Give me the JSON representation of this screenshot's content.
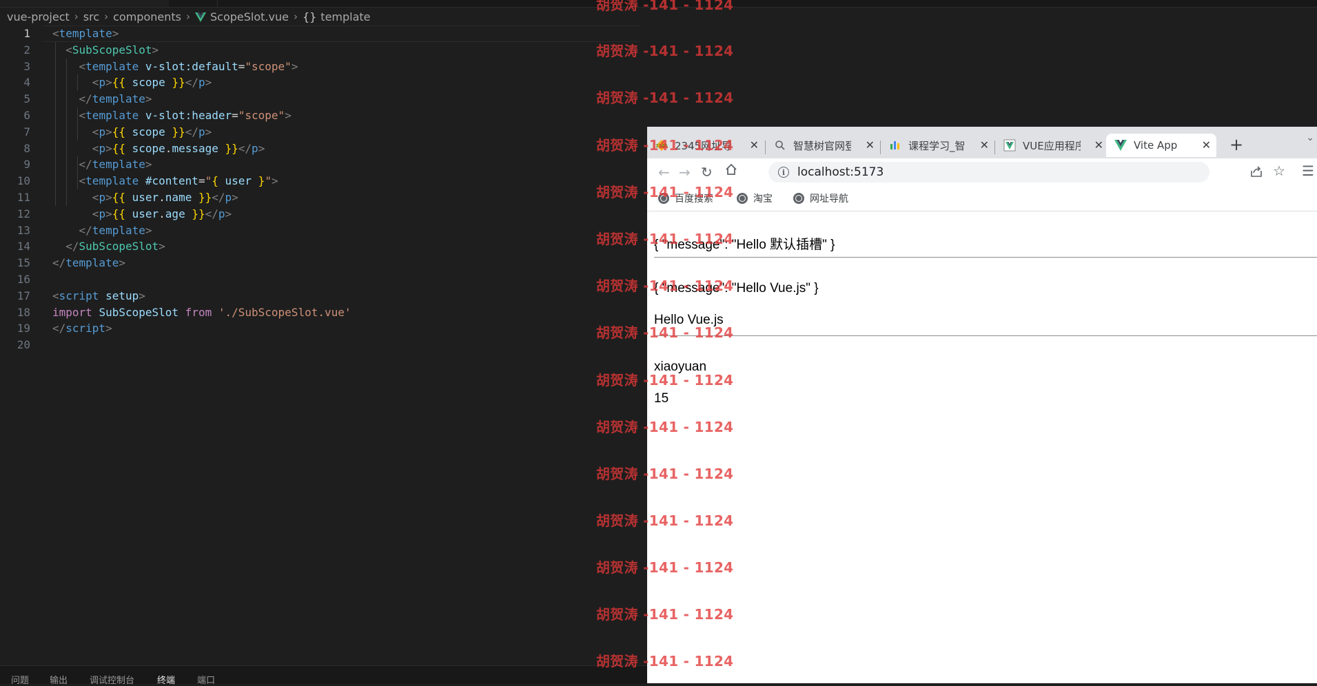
{
  "breadcrumb": {
    "items": [
      "vue-project",
      "src",
      "components",
      "ScopeSlot.vue",
      "template"
    ]
  },
  "code": {
    "line_numbers": [
      "1",
      "2",
      "3",
      "4",
      "5",
      "6",
      "7",
      "8",
      "9",
      "10",
      "11",
      "12",
      "13",
      "14",
      "15",
      "16",
      "17",
      "18",
      "19",
      "20"
    ]
  },
  "panel": {
    "tabs": [
      "问题",
      "输出",
      "调试控制台",
      "终端",
      "端口"
    ]
  },
  "watermark": {
    "text": "胡贺涛 -141 - 1124",
    "text_alt": "胡贺涛 -141 - 1124"
  },
  "browser": {
    "tabs": [
      {
        "title": "2345网址导航",
        "favicon": "2345-icon"
      },
      {
        "title": "智慧树官网登",
        "favicon": "search-icon"
      },
      {
        "title": "课程学习_智",
        "favicon": "course-icon"
      },
      {
        "title": "VUE应用程序",
        "favicon": "vue-image-icon"
      },
      {
        "title": "Vite App",
        "favicon": "vue-icon"
      }
    ],
    "url": "localhost:5173",
    "bookmarks": [
      "百度搜索",
      "淘宝",
      "网址导航"
    ],
    "page": {
      "default_slot": "{ \"message\": \"Hello 默认插槽\" }",
      "header_scope": "{ \"message\": \"Hello Vue.js\" }",
      "header_message": "Hello Vue.js",
      "user_name": "xiaoyuan",
      "user_age": "15"
    }
  },
  "colors": {
    "editor_bg": "#1e1e1e",
    "tag": "#569cd6",
    "component": "#4ec9b0",
    "attribute": "#9cdcfe",
    "string": "#ce9178",
    "mustache": "#ffd700",
    "keyword": "#c586c0",
    "watermark": "#e13737"
  }
}
